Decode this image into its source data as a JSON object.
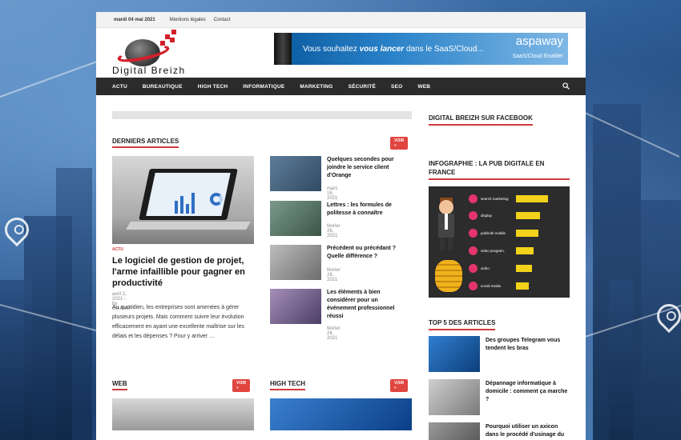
{
  "topbar": {
    "date": "mardi 04 mai 2021",
    "links": [
      "Mentions légales",
      "Contact"
    ]
  },
  "logo": {
    "text": "Digital Breizh"
  },
  "banner": {
    "message_pre": "Vous souhaitez ",
    "message_em": "vous lancer",
    "message_post": " dans le SaaS/Cloud...",
    "brand": "aspaway",
    "tagline": "SaaS/Cloud Enabler"
  },
  "nav": {
    "items": [
      "ACTU",
      "BUREAUTIQUE",
      "HIGH TECH",
      "INFORMATIQUE",
      "MARKETING",
      "SÉCURITÉ",
      "SEO",
      "WEB"
    ],
    "search_icon": "search-icon"
  },
  "main": {
    "latest": {
      "title": "DERNIERS ARTICLES",
      "voir": "VOIR »",
      "featured": {
        "category": "ACTU",
        "title": "Le logiciel de gestion de projet, l'arme infaillible pour gagner en productivité",
        "date": "avril 2, 2021",
        "author_prefix": " - by ",
        "author": "Goulven",
        "excerpt": "Au quotidien, les entreprises sont amenées à gérer plusieurs projets. Mais comment suivre leur évolution efficacement en ayant une excellente maîtrise sur les délais et les dépenses ? Pour y arriver …"
      },
      "list": [
        {
          "title": "Quelques secondes pour joindre le service client d'Orange",
          "date": "mars 16, 2021"
        },
        {
          "title": "Lettres : les formules de politesse à connaître",
          "date": "février 26, 2021"
        },
        {
          "title": "Précédent ou précédant ? Quelle différence ?",
          "date": "février 26, 2021"
        },
        {
          "title": "Les éléments à bien considérer pour un événement professionnel réussi",
          "date": "février 24, 2021"
        }
      ]
    },
    "web": {
      "title": "WEB",
      "voir": "VOIR »"
    },
    "hightech": {
      "title": "HIGH TECH",
      "voir": "VOIR »"
    }
  },
  "sidebar": {
    "facebook_title": "DIGITAL BREIZH SUR FACEBOOK",
    "infographic_title": "INFOGRAPHIE : LA PUB DIGITALE EN FRANCE",
    "infographic": {
      "header": "3 MILLIARDS D'EUROS",
      "rows": [
        {
          "label": "search marketing",
          "value": "1 milliard"
        },
        {
          "label": "display",
          "value": "1 milliard"
        },
        {
          "label": "publicité mobile",
          "value": "503 millions"
        },
        {
          "label": "video program.",
          "value": ""
        },
        {
          "label": "vidéo",
          "value": ""
        },
        {
          "label": "social media",
          "value": ""
        }
      ]
    },
    "top5_title": "TOP 5 DES ARTICLES",
    "top5": [
      {
        "title": "Des groupes Telegram vous tendent les bras"
      },
      {
        "title": "Dépannage informatique à domicile : comment ça marche ?"
      },
      {
        "title": "Pourquoi utiliser un axicon dans le procédé d'usinage du"
      }
    ]
  }
}
